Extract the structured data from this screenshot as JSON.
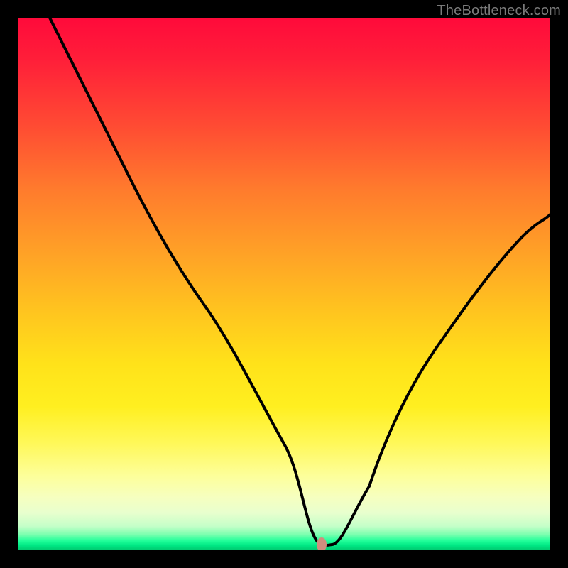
{
  "watermark": "TheBottleneck.com",
  "chart_data": {
    "type": "line",
    "title": "",
    "xlabel": "",
    "ylabel": "",
    "xlim": [
      0,
      100
    ],
    "ylim": [
      0,
      100
    ],
    "background_gradient": {
      "top": "#ff0a3a",
      "mid": "#ffe21a",
      "bottom": "#00c86e"
    },
    "series": [
      {
        "name": "bottleneck-curve",
        "x": [
          6,
          10,
          15,
          20,
          25,
          30,
          35,
          40,
          45,
          48,
          51,
          53,
          55,
          56,
          57,
          59,
          62,
          66,
          70,
          75,
          80,
          85,
          90,
          95,
          100
        ],
        "y": [
          100,
          92,
          82,
          72,
          62,
          53,
          44,
          36,
          27,
          22,
          15,
          10,
          5,
          2,
          1,
          1,
          4,
          10,
          17,
          25,
          33,
          41,
          49,
          56,
          63
        ]
      }
    ],
    "marker": {
      "name": "optimal-point",
      "x": 57,
      "y": 1,
      "color": "#d18e7e"
    },
    "annotations": []
  }
}
